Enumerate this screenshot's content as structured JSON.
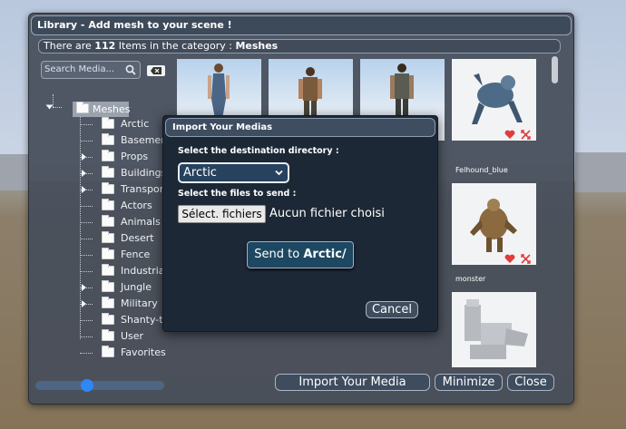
{
  "library": {
    "title": "Library - Add mesh to your scene !",
    "info_prefix": "There are",
    "count": "112",
    "info_mid": "Items in the category :",
    "category": "Meshes",
    "search_placeholder": "Search Media...",
    "tree": {
      "root": "Meshes",
      "items": [
        {
          "label": "Arctic",
          "expandable": false
        },
        {
          "label": "Basement",
          "expandable": false
        },
        {
          "label": "Props",
          "expandable": true
        },
        {
          "label": "Buildings",
          "expandable": true
        },
        {
          "label": "Transports",
          "expandable": true
        },
        {
          "label": "Actors",
          "expandable": false
        },
        {
          "label": "Animals",
          "expandable": false
        },
        {
          "label": "Desert",
          "expandable": false
        },
        {
          "label": "Fence",
          "expandable": false
        },
        {
          "label": "Industrial",
          "expandable": false
        },
        {
          "label": "Jungle",
          "expandable": true
        },
        {
          "label": "Military",
          "expandable": true
        },
        {
          "label": "Shanty-town",
          "expandable": false
        },
        {
          "label": "User",
          "expandable": false
        },
        {
          "label": "Favorites",
          "expandable": false
        }
      ]
    },
    "thumbnails": [
      {
        "label": ""
      },
      {
        "label": ""
      },
      {
        "label": ""
      },
      {
        "label": "Felhound_blue"
      },
      {
        "label": "monster"
      }
    ],
    "import_button": "Import Your Media",
    "minimize_button": "Minimize",
    "close_button": "Close",
    "zoom_slider": 0.4
  },
  "import_dialog": {
    "title": "Import Your Medias",
    "dest_label": "Select the destination directory :",
    "dest_value": "Arctic",
    "files_label": "Select the files to send :",
    "file_button": "Sélect. fichiers",
    "file_status": "Aucun fichier choisi",
    "send_prefix": "Send to",
    "send_target": "Arctic/",
    "cancel_button": "Cancel"
  },
  "colors": {
    "panel": "#464e5a",
    "accent": "#2f86f6",
    "heart": "#e23b3b"
  }
}
